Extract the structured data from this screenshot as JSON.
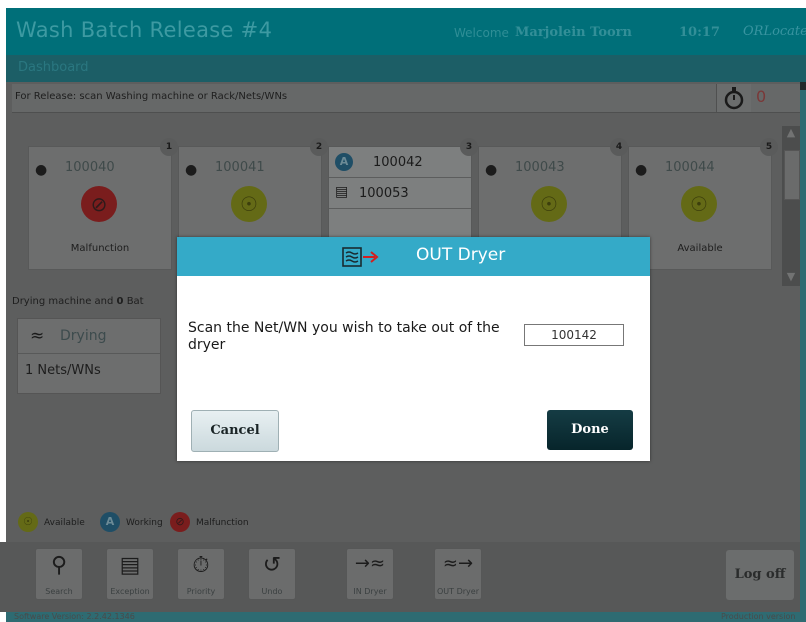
{
  "header": {
    "title": "Wash Batch Release #4",
    "welcome_label": "Welcome",
    "user_name": "Marjolein Toorn",
    "time": "10:17",
    "brand": "ORLocate"
  },
  "subheader": {
    "label": "Dashboard"
  },
  "instruction": {
    "text": "For Release: scan Washing machine or Rack/Nets/WNs",
    "priority_count": "0"
  },
  "machines": [
    {
      "slot": "1",
      "id": "100040",
      "status": "Malfunction"
    },
    {
      "slot": "2",
      "id": "100041",
      "status": ""
    },
    {
      "slot": "3",
      "id": "100042",
      "sub_id": "100053",
      "status": ""
    },
    {
      "slot": "4",
      "id": "100043",
      "status": ""
    },
    {
      "slot": "5",
      "id": "100044",
      "status": "Available"
    }
  ],
  "drying": {
    "summary_prefix": "Drying machine and",
    "summary_count": "0",
    "summary_suffix": "Bat",
    "panel_title": "Drying",
    "panel_count": "1 Nets/WNs"
  },
  "legend": {
    "available": "Available",
    "working": "Working",
    "malfunction": "Malfunction"
  },
  "toolbar": {
    "search": "Search",
    "exception": "Exception",
    "priority": "Priority",
    "undo": "Undo",
    "in_dryer": "IN Dryer",
    "out_dryer": "OUT Dryer",
    "log_off": "Log off"
  },
  "footer": {
    "version": "Software Version: 2.2.42.1346",
    "environment": "Production version"
  },
  "dialog": {
    "title": "OUT Dryer",
    "message": "Scan the Net/WN you wish to take out of the dryer",
    "input_value": "100142",
    "cancel_label": "Cancel",
    "done_label": "Done",
    "accent_color": "#34aac8"
  }
}
